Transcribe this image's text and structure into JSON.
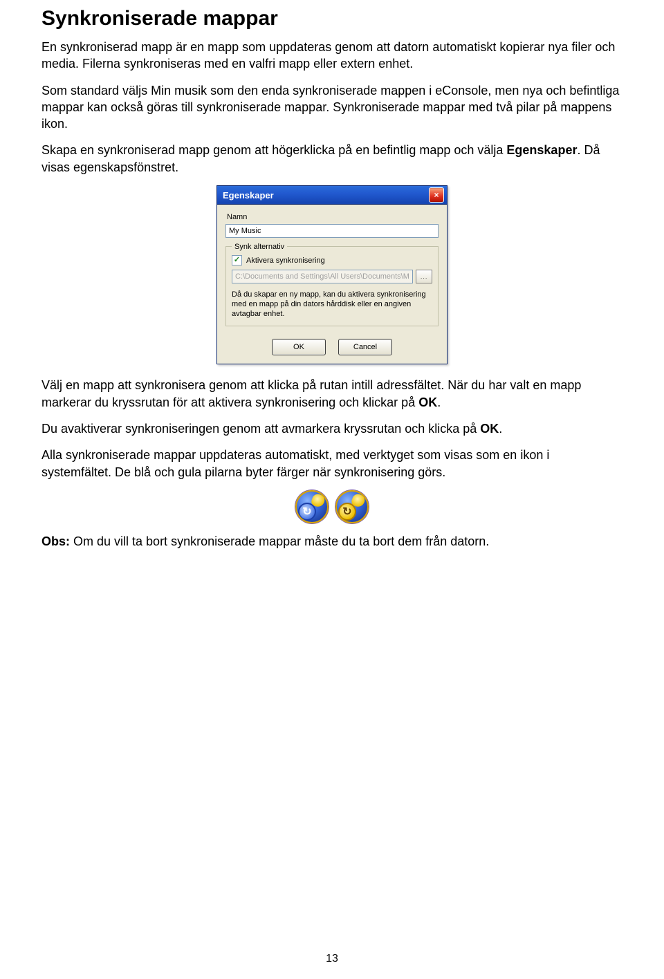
{
  "doc": {
    "title": "Synkroniserade mappar",
    "p1": "En synkroniserad mapp är en mapp som uppdateras genom att datorn automatiskt kopierar nya filer och media. Filerna synkroniseras med en valfri mapp eller extern enhet.",
    "p2": "Som standard väljs Min musik som den enda synkroniserade mappen i eConsole, men nya och befintliga mappar kan också göras till synkroniserade mappar. Synkroniserade mappar med två pilar på mappens ikon.",
    "p3_a": "Skapa en synkroniserad mapp genom att högerklicka på en befintlig mapp och välja ",
    "p3_b": "Egenskaper",
    "p3_c": ". Då visas egenskapsfönstret.",
    "p4_a": "Välj en mapp att synkronisera genom att klicka på rutan intill adressfältet. När du har valt en mapp markerar du kryssrutan för att aktivera synkronisering och klickar på ",
    "p4_b": "OK",
    "p4_c": ".",
    "p5_a": "Du avaktiverar synkroniseringen genom att avmarkera kryssrutan och klicka på ",
    "p5_b": "OK",
    "p5_c": ".",
    "p6": "Alla synkroniserade mappar uppdateras automatiskt, med verktyget som visas som en ikon i systemfältet. De blå och gula pilarna byter färger när synkronisering görs.",
    "p7_a": "Obs:",
    "p7_b": " Om du vill ta bort synkroniserade mappar måste du ta bort dem från datorn.",
    "page_number": "13"
  },
  "dialog": {
    "title": "Egenskaper",
    "name_label": "Namn",
    "name_value": "My Music",
    "fieldset_legend": "Synk alternativ",
    "checkbox_label": "Aktivera synkronisering",
    "checkbox_checked": true,
    "path_value": "C:\\Documents and Settings\\All Users\\Documents\\My Music",
    "browse_label": "...",
    "description": "Då du skapar en ny mapp, kan du aktivera synkronisering med en mapp på din dators hårddisk eller en angiven avtagbar enhet.",
    "ok_label": "OK",
    "cancel_label": "Cancel"
  }
}
